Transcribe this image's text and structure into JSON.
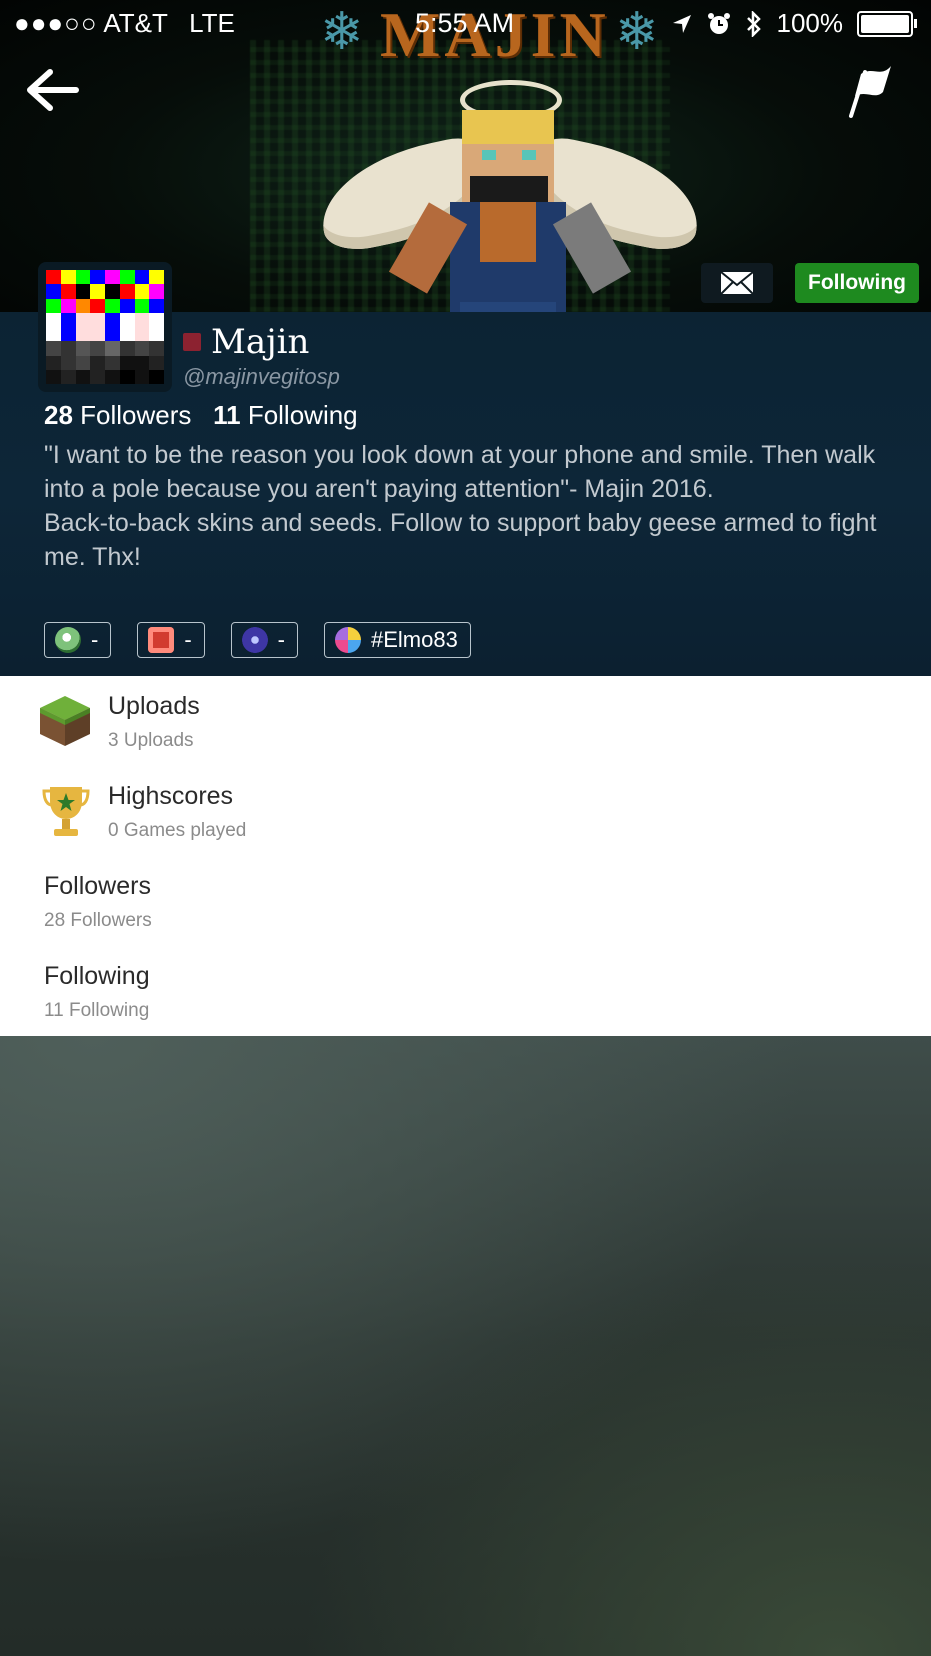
{
  "status_bar": {
    "signal": "●●●○○",
    "carrier": "AT&T",
    "network": "LTE",
    "time": "5:55 AM",
    "battery": "100%"
  },
  "banner": {
    "title_text": "MAJIN"
  },
  "header": {
    "back_icon": "arrow-left-icon",
    "report_icon": "flag-icon",
    "message_icon": "envelope-icon",
    "follow_label": "Following",
    "follow_color": "#1e8a1f"
  },
  "profile": {
    "name": "Majin",
    "handle": "@majinvegitosp",
    "followers_count": "28",
    "followers_label": "Followers",
    "following_count": "11",
    "following_label": "Following",
    "bio": "\"I want to be the reason you look down at your phone and smile. Then walk into a pole because you aren't paying attention\"- Majin 2016.\nBack-to-back skins and seeds. Follow to support baby geese armed to fight me. Thx!",
    "status_color": "#8c2230",
    "gamertags": [
      {
        "platform_icon": "xbox-icon",
        "value": "-"
      },
      {
        "platform_icon": "nintendo-icon",
        "value": "-"
      },
      {
        "platform_icon": "playstation-icon",
        "value": "-"
      },
      {
        "platform_icon": "game-center-icon",
        "value": "#Elmo83"
      }
    ]
  },
  "menu": {
    "uploads": {
      "title": "Uploads",
      "subtitle": "3 Uploads",
      "icon": "grass-block-icon"
    },
    "highscores": {
      "title": "Highscores",
      "subtitle": "0 Games played",
      "icon": "trophy-icon"
    },
    "followers": {
      "title": "Followers",
      "subtitle": "28 Followers"
    },
    "following": {
      "title": "Following",
      "subtitle": "11 Following"
    }
  }
}
